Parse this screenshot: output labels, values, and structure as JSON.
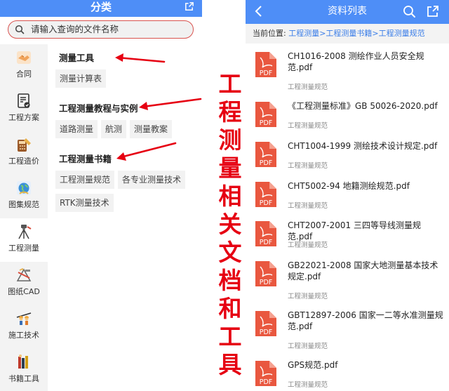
{
  "left": {
    "title": "分类",
    "search_placeholder": "请输入查询的文件名称",
    "nav": [
      {
        "label": "合同",
        "icon": "handshake-icon"
      },
      {
        "label": "工程方案",
        "icon": "document-check-icon"
      },
      {
        "label": "工程造价",
        "icon": "calculator-icon"
      },
      {
        "label": "图集规范",
        "icon": "globe-icon"
      },
      {
        "label": "工程测量",
        "icon": "tripod-icon",
        "active": true
      },
      {
        "label": "图纸CAD",
        "icon": "drafting-tools-icon"
      },
      {
        "label": "施工技术",
        "icon": "construction-workers-icon"
      },
      {
        "label": "书籍工具",
        "icon": "books-icon"
      }
    ],
    "sections": [
      {
        "title": "测量工具",
        "items": [
          "测量计算表"
        ]
      },
      {
        "title": "工程测量教程与实例",
        "items": [
          "道路测量",
          "航测",
          "测量教案"
        ]
      },
      {
        "title": "工程测量书籍",
        "items": [
          "工程测量规范",
          "各专业测量技术",
          "RTK测量技术"
        ]
      }
    ]
  },
  "vertical_title": [
    "工",
    "程",
    "测",
    "量",
    "相",
    "关",
    "文",
    "档",
    "和",
    "工",
    "具"
  ],
  "right": {
    "title": "资料列表",
    "crumb_label": "当前位置:",
    "crumb_path": "工程测量>工程测量书籍>工程测量规范",
    "files": [
      {
        "name": "CH1016-2008 测绘作业人员安全规范.pdf",
        "category": "工程测量规范"
      },
      {
        "name": "《工程测量标准》GB 50026-2020.pdf",
        "category": "工程测量规范"
      },
      {
        "name": "CHT1004-1999 测绘技术设计规定.pdf",
        "category": "工程测量规范"
      },
      {
        "name": "CHT5002-94 地籍测绘规范.pdf",
        "category": "工程测量规范"
      },
      {
        "name": "CHT2007-2001 三四等导线测量规范.pdf",
        "category": "工程测量规范"
      },
      {
        "name": "GB22021-2008 国家大地测量基本技术规定.pdf",
        "category": "工程测量规范"
      },
      {
        "name": "GBT12897-2006 国家一二等水准测量规范.pdf",
        "category": "工程测量规范"
      },
      {
        "name": "GPS规范.pdf",
        "category": "工程测量规范"
      }
    ],
    "pdf_badge": "PDF"
  },
  "colors": {
    "header_blue": "#4e8ef7",
    "accent_red": "#e60012",
    "pdf_red": "#e9573f",
    "link_blue": "#3b7ee8"
  }
}
